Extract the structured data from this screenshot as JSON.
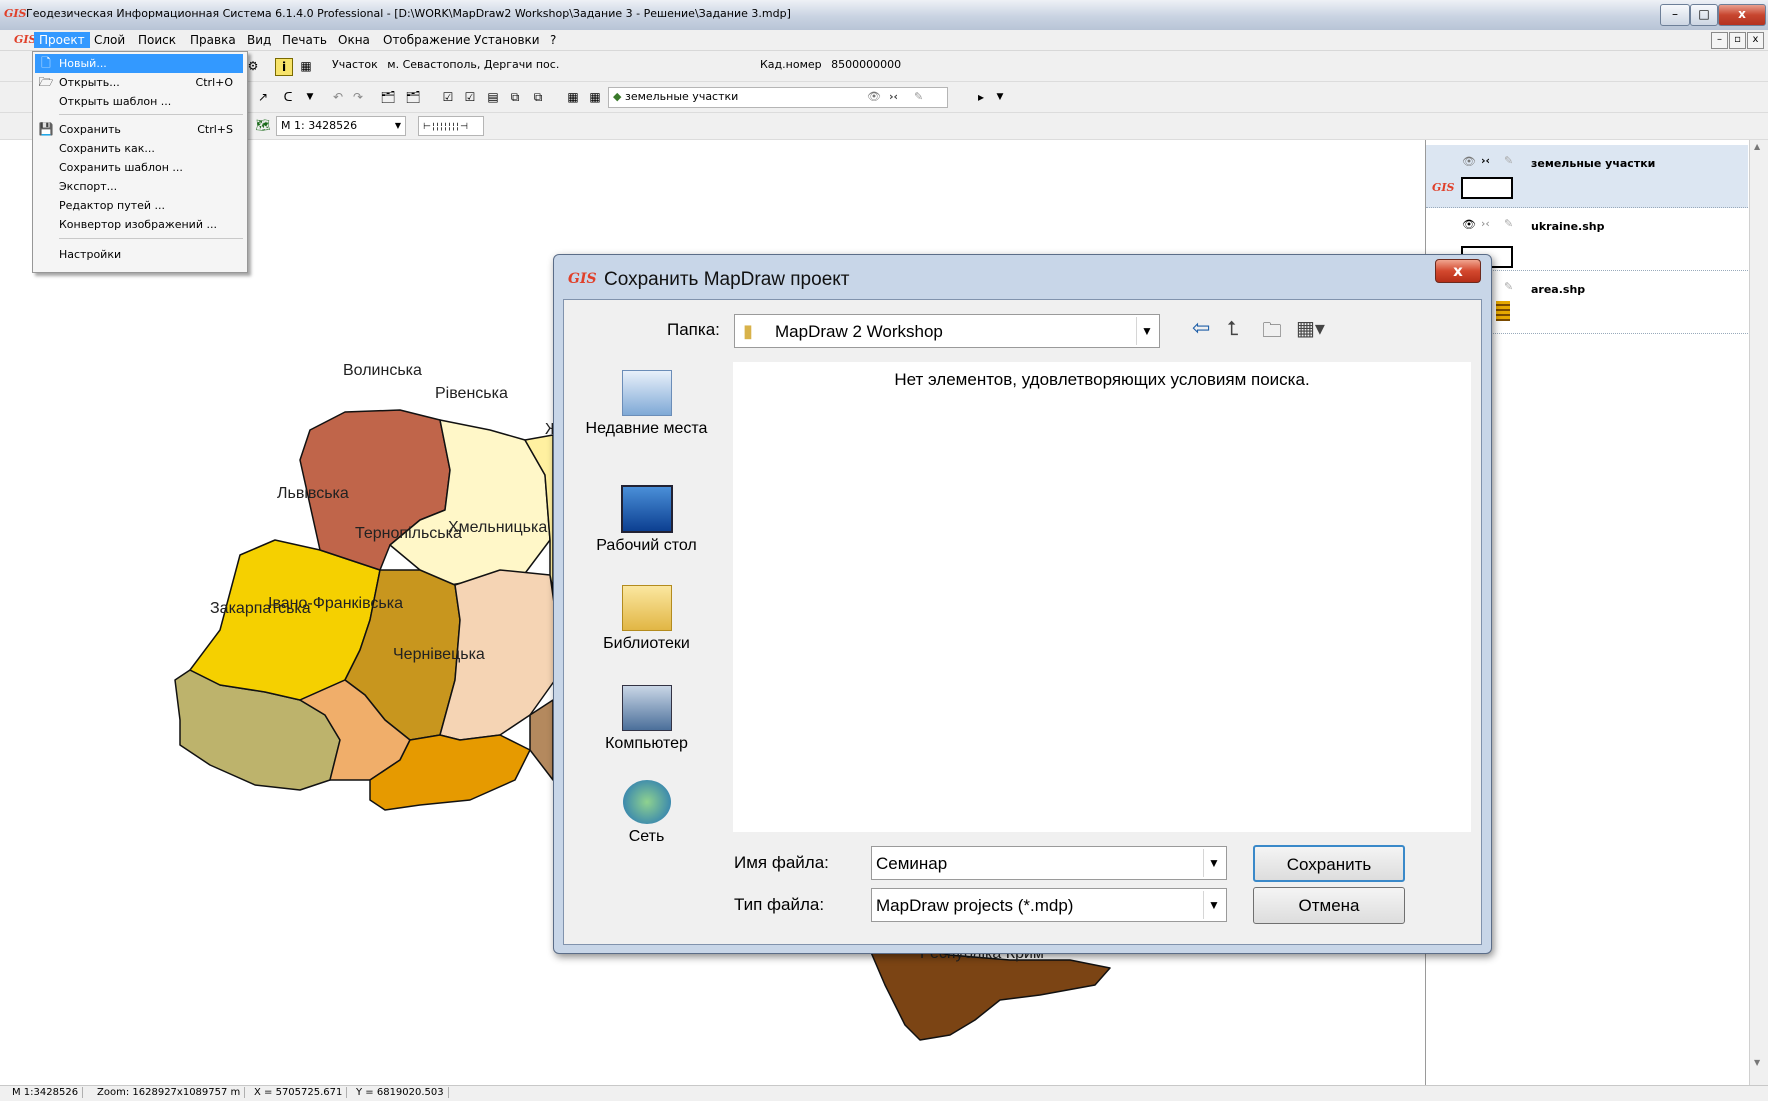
{
  "window": {
    "logo": "GIS",
    "title": "Геодезическая Информационная Система 6.1.4.0 Professional - [D:\\WORK\\MapDraw2 Workshop\\Задание 3 - Решение\\Задание 3.mdp]",
    "btn_min": "–",
    "btn_max": "□",
    "btn_close": "x"
  },
  "menubar": {
    "items": [
      "Проект",
      "Слой",
      "Поиск",
      "Правка",
      "Вид",
      "Печать",
      "Окна",
      "Отображение",
      "Установки",
      "?"
    ],
    "mdi_buttons": [
      "–",
      "▫",
      "x"
    ]
  },
  "toolbar1": {
    "parcel_label": "Участок",
    "parcel_value": "м. Севастополь, Дергачи пос.",
    "cad_label": "Кад.номер",
    "cad_value": "8500000000"
  },
  "toolbar2": {
    "layer_combo": "земельные участки"
  },
  "toolbar3": {
    "scale_value": "М 1: 3428526"
  },
  "project_menu": {
    "items": [
      {
        "label": "Новый...",
        "shortcut": ""
      },
      {
        "label": "Открыть...",
        "shortcut": "Ctrl+O"
      },
      {
        "label": "Открыть шаблон ...",
        "shortcut": ""
      },
      {
        "label": "Сохранить",
        "shortcut": "Ctrl+S"
      },
      {
        "label": "Сохранить как...",
        "shortcut": ""
      },
      {
        "label": "Сохранить шаблон ...",
        "shortcut": ""
      },
      {
        "label": "Экспорт...",
        "shortcut": ""
      },
      {
        "label": "Редактор путей ...",
        "shortcut": ""
      },
      {
        "label": "Конвертор изображений ...",
        "shortcut": ""
      },
      {
        "label": "Настройки",
        "shortcut": ""
      }
    ]
  },
  "map": {
    "regions": [
      "Волинська",
      "Рівенська",
      "Львівська",
      "Тернопільська",
      "Хмельницька",
      "Закарпатська",
      "Івано-Франківська",
      "Чернівецька",
      "Ж",
      "Республіка Крим"
    ],
    "colors": {
      "volyn": "#c0654a",
      "rivne": "#fff7c8",
      "lviv": "#f5d000",
      "ternopil": "#c8961e",
      "khmelnytsk": "#f5d4b4",
      "zakarpattia": "#bdb36c",
      "ivano": "#f0ae6a",
      "chernivtsi": "#e69a00",
      "zhytomyr": "#fff0a0",
      "vinnytsia": "#b4895e",
      "crimea": "#7b4414"
    }
  },
  "layers": [
    {
      "name": "земельные участки",
      "selected": true
    },
    {
      "name": "ukraine.shp",
      "selected": false
    },
    {
      "name": "area.shp",
      "selected": false
    }
  ],
  "dialog": {
    "title": "Сохранить MapDraw проект",
    "folder_label": "Папка:",
    "folder_value": "MapDraw 2 Workshop",
    "empty_message": "Нет элементов, удовлетворяющих условиям поиска.",
    "places": [
      "Недавние места",
      "Рабочий стол",
      "Библиотеки",
      "Компьютер",
      "Сеть"
    ],
    "filename_label": "Имя файла:",
    "filename_value": "Семинар",
    "filetype_label": "Тип файла:",
    "filetype_value": "MapDraw projects (*.mdp)",
    "save_button": "Сохранить",
    "cancel_button": "Отмена"
  },
  "status": {
    "scale": "М 1:3428526",
    "zoom": "Zoom: 1628927x1089757 m",
    "x": "X = 5705725.671",
    "y": "Y = 6819020.503"
  }
}
